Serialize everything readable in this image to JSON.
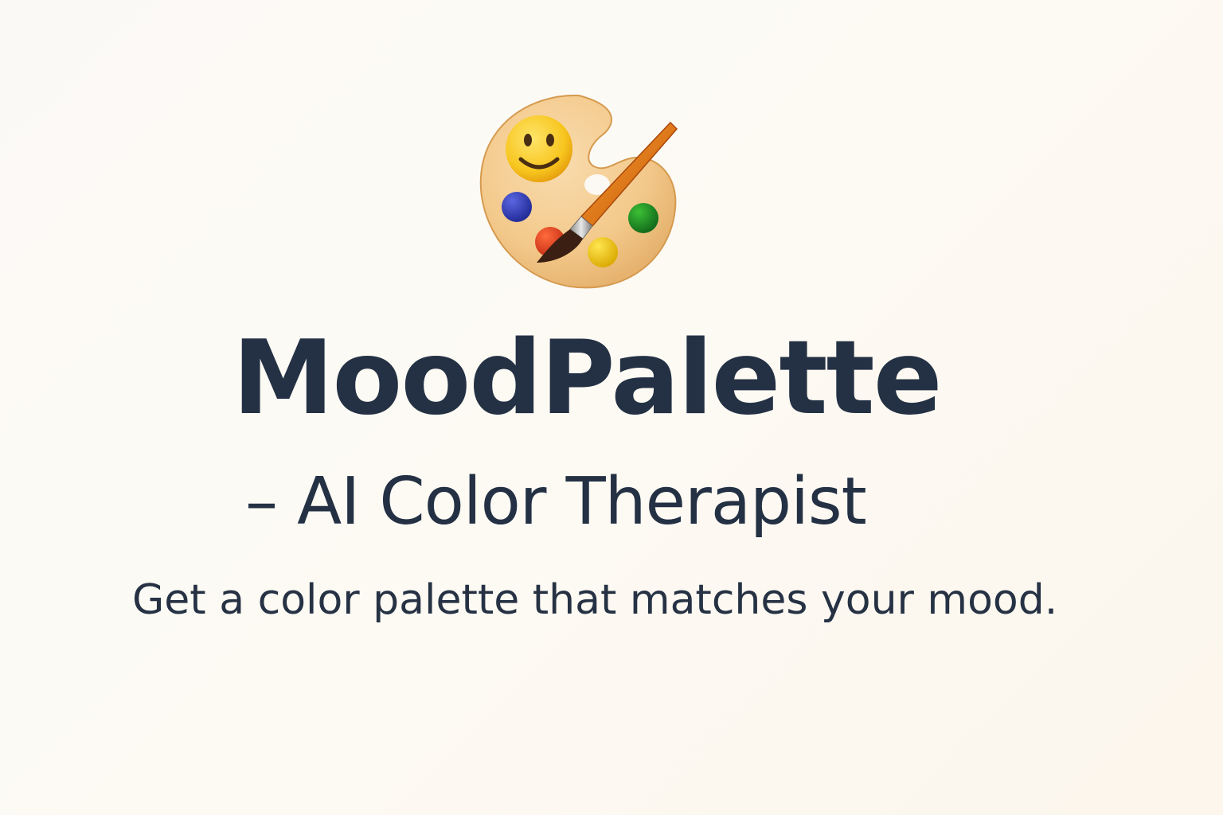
{
  "app": {
    "logo_icon": "palette-with-smiley-and-brush-icon",
    "title": "MoodPalette",
    "subtitle": "– AI Color Therapist",
    "tagline": "Get a color palette that matches your mood."
  },
  "colors": {
    "text": "#243144",
    "background": "#fcf9f4",
    "palette_wood": "#f3c98b",
    "paint_blue": "#2e3bb4",
    "paint_green": "#1f8a1f",
    "paint_red": "#e03b1c",
    "paint_yellow": "#f2cc12",
    "brush_handle": "#e97a17"
  }
}
